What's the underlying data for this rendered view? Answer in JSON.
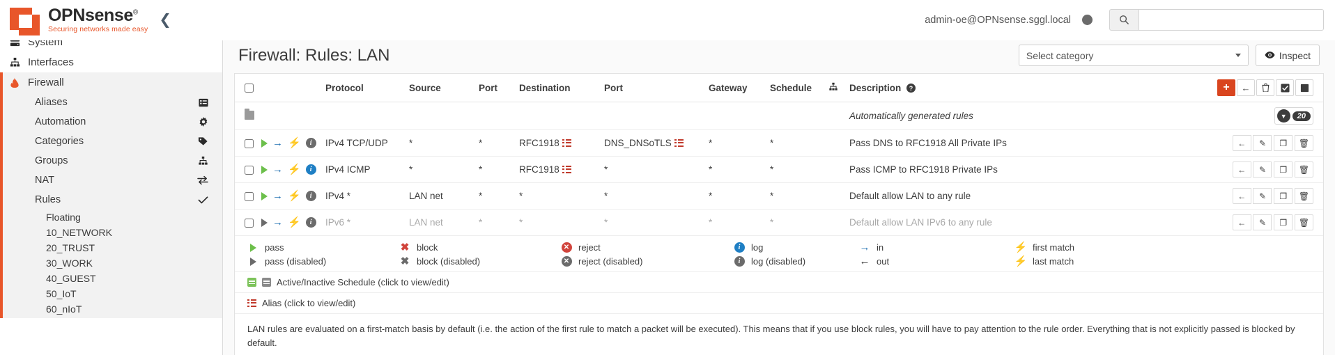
{
  "header": {
    "brand_name": "OPNsense",
    "brand_reg": "®",
    "brand_tagline": "Securing networks made easy",
    "collapse_icon": "chevron-left-icon",
    "username": "admin-oe@OPNsense.sggl.local",
    "search_placeholder": "",
    "search_value": "",
    "search_icon": "search-icon",
    "accent_color": "#e8562a"
  },
  "sidebar": {
    "items": [
      {
        "label": "System",
        "icon": "server-icon"
      },
      {
        "label": "Interfaces",
        "icon": "sitemap-icon"
      },
      {
        "label": "Firewall",
        "icon": "fire-icon",
        "active": true
      }
    ],
    "firewall_children": [
      {
        "label": "Aliases",
        "icon": "list-icon"
      },
      {
        "label": "Automation",
        "icon": "gear-icon"
      },
      {
        "label": "Categories",
        "icon": "tag-icon"
      },
      {
        "label": "Groups",
        "icon": "sitemap-icon"
      },
      {
        "label": "NAT",
        "icon": "exchange-icon"
      },
      {
        "label": "Rules",
        "icon": "check-icon",
        "active": true
      }
    ],
    "rules_children": [
      {
        "label": "Floating"
      },
      {
        "label": "10_NETWORK"
      },
      {
        "label": "20_TRUST"
      },
      {
        "label": "30_WORK"
      },
      {
        "label": "40_GUEST"
      },
      {
        "label": "50_IoT"
      },
      {
        "label": "60_nIoT"
      }
    ]
  },
  "page": {
    "title": "Firewall: Rules: LAN",
    "select_category_label": "Select category",
    "select_category_icon": "chevron-down-icon",
    "inspect_label": "Inspect",
    "inspect_icon": "eye-icon"
  },
  "table": {
    "columns": [
      "",
      "",
      "Protocol",
      "Source",
      "Port",
      "Destination",
      "Port",
      "Gateway",
      "Schedule",
      "",
      "Description",
      ""
    ],
    "description_help_icon": "question-circle-icon",
    "category_header_icon": "sitemap-icon",
    "toolbar": [
      {
        "name": "add-rule-button",
        "icon": "plus-icon",
        "primary": true
      },
      {
        "name": "move-rule-button",
        "icon": "arrow-left-icon"
      },
      {
        "name": "delete-selected-button",
        "icon": "trash-icon"
      },
      {
        "name": "toggle-selected-button",
        "icon": "checkbox-icon"
      },
      {
        "name": "stop-selected-button",
        "icon": "square-icon"
      }
    ],
    "auto_row": {
      "folder_icon": "folder-icon",
      "description": "Automatically generated rules",
      "expand_icon": "chevron-down-icon",
      "count": "20"
    },
    "rows": [
      {
        "enabled": true,
        "action_icon": "play-icon",
        "direction_icon": "arrow-right-icon",
        "match_icon": "bolt-icon",
        "log_icon": "info-icon",
        "log_color": "gray",
        "protocol": "IPv4 TCP/UDP",
        "source": "*",
        "port": "*",
        "destination": "RFC1918",
        "destination_alias": true,
        "port2": "DNS_DNSoTLS",
        "port2_alias": true,
        "gateway": "*",
        "schedule": "*",
        "description": "Pass DNS to RFC1918 All Private IPs"
      },
      {
        "enabled": true,
        "action_icon": "play-icon",
        "direction_icon": "arrow-right-icon",
        "match_icon": "bolt-icon",
        "log_icon": "info-icon",
        "log_color": "blue",
        "protocol": "IPv4 ICMP",
        "source": "*",
        "port": "*",
        "destination": "RFC1918",
        "destination_alias": true,
        "port2": "*",
        "port2_alias": false,
        "gateway": "*",
        "schedule": "*",
        "description": "Pass ICMP to RFC1918 Private IPs"
      },
      {
        "enabled": true,
        "action_icon": "play-icon",
        "direction_icon": "arrow-right-icon",
        "match_icon": "bolt-icon",
        "log_icon": "info-icon",
        "log_color": "gray",
        "protocol": "IPv4 *",
        "source": "LAN net",
        "port": "*",
        "destination": "*",
        "destination_alias": false,
        "port2": "*",
        "port2_alias": false,
        "gateway": "*",
        "schedule": "*",
        "description": "Default allow LAN to any rule"
      },
      {
        "enabled": false,
        "action_icon": "play-icon",
        "direction_icon": "arrow-right-icon",
        "match_icon": "bolt-icon",
        "log_icon": "info-icon",
        "log_color": "gray",
        "protocol": "IPv6 *",
        "source": "LAN net",
        "port": "*",
        "destination": "*",
        "destination_alias": false,
        "port2": "*",
        "port2_alias": false,
        "gateway": "*",
        "schedule": "*",
        "description": "Default allow LAN IPv6 to any rule"
      }
    ],
    "row_actions": [
      {
        "name": "move-rule-button",
        "icon": "arrow-left-icon"
      },
      {
        "name": "edit-rule-button",
        "icon": "pencil-icon"
      },
      {
        "name": "clone-rule-button",
        "icon": "copy-icon"
      },
      {
        "name": "delete-rule-button",
        "icon": "trash-icon"
      }
    ]
  },
  "legend": {
    "columns": [
      {
        "rows": [
          {
            "icon": "play-icon",
            "label": "pass"
          },
          {
            "icon": "play-disabled-icon",
            "label": "pass (disabled)"
          }
        ]
      },
      {
        "rows": [
          {
            "icon": "x-icon",
            "label": "block"
          },
          {
            "icon": "x-disabled-icon",
            "label": "block (disabled)"
          }
        ]
      },
      {
        "rows": [
          {
            "icon": "reject-icon",
            "label": "reject"
          },
          {
            "icon": "reject-disabled-icon",
            "label": "reject (disabled)"
          }
        ]
      },
      {
        "rows": [
          {
            "icon": "info-icon",
            "label": "log"
          },
          {
            "icon": "info-disabled-icon",
            "label": "log (disabled)"
          }
        ]
      },
      {
        "rows": [
          {
            "icon": "arrow-right-icon",
            "label": "in"
          },
          {
            "icon": "arrow-left-icon",
            "label": "out"
          }
        ]
      },
      {
        "rows": [
          {
            "icon": "bolt-icon",
            "label": "first match"
          },
          {
            "icon": "bolt-dark-icon",
            "label": "last match"
          }
        ]
      }
    ],
    "schedule_label": "Active/Inactive Schedule (click to view/edit)",
    "schedule_icons": [
      "calendar-green-icon",
      "calendar-gray-icon"
    ],
    "alias_label": "Alias (click to view/edit)",
    "alias_icon": "alias-list-icon"
  },
  "footer": {
    "note": "LAN rules are evaluated on a first-match basis by default (i.e. the action of the first rule to match a packet will be executed). This means that if you use block rules, you will have to pay attention to the rule order. Everything that is not explicitly passed is blocked by default."
  }
}
